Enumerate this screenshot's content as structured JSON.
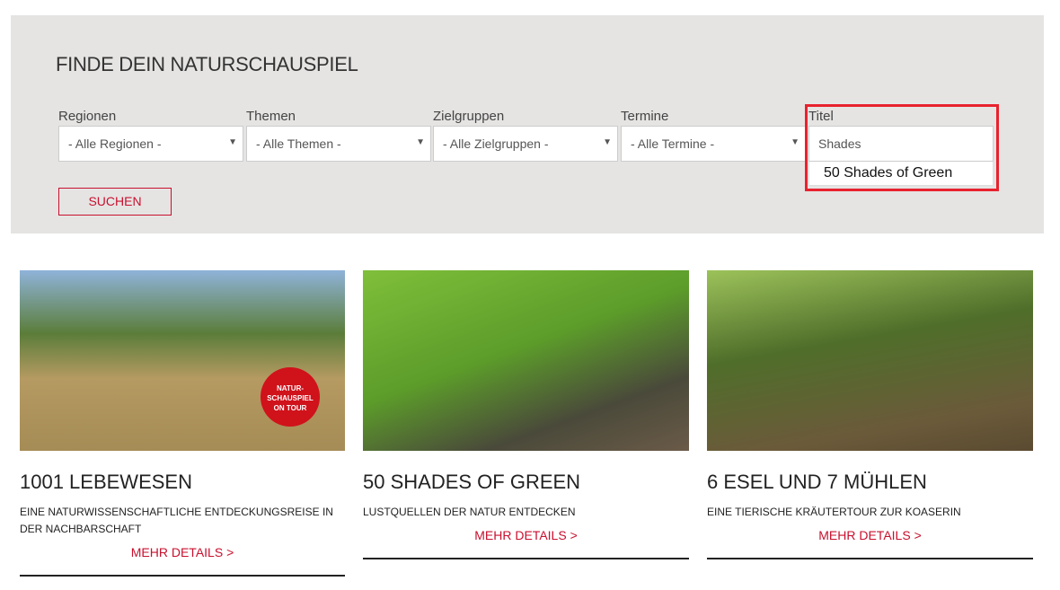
{
  "search": {
    "title": "FINDE DEIN NATURSCHAUSPIEL",
    "fields": [
      {
        "label": "Regionen",
        "value": "- Alle Regionen -"
      },
      {
        "label": "Themen",
        "value": "- Alle Themen -"
      },
      {
        "label": "Zielgruppen",
        "value": "- Alle Zielgruppen -"
      },
      {
        "label": "Termine",
        "value": "- Alle Termine -"
      }
    ],
    "titel": {
      "label": "Titel",
      "value": "Shades",
      "suggestion": "50 Shades of Green"
    },
    "button": "SUCHEN"
  },
  "cards": [
    {
      "title": "1001 LEBEWESEN",
      "desc": "EINE NATURWISSENSCHAFTLICHE ENTDECKUNGSREISE IN DER NACHBARSCHAFT",
      "link": "MEHR DETAILS >",
      "badge": "NATUR-SCHAUSPIEL ON TOUR"
    },
    {
      "title": "50 SHADES OF GREEN",
      "desc": "LUSTQUELLEN DER NATUR ENTDECKEN",
      "link": "MEHR DETAILS >"
    },
    {
      "title": "6 ESEL UND 7 MÜHLEN",
      "desc": "EINE TIERISCHE KRÄUTERTOUR ZUR KOASERIN",
      "link": "MEHR DETAILS >"
    }
  ]
}
